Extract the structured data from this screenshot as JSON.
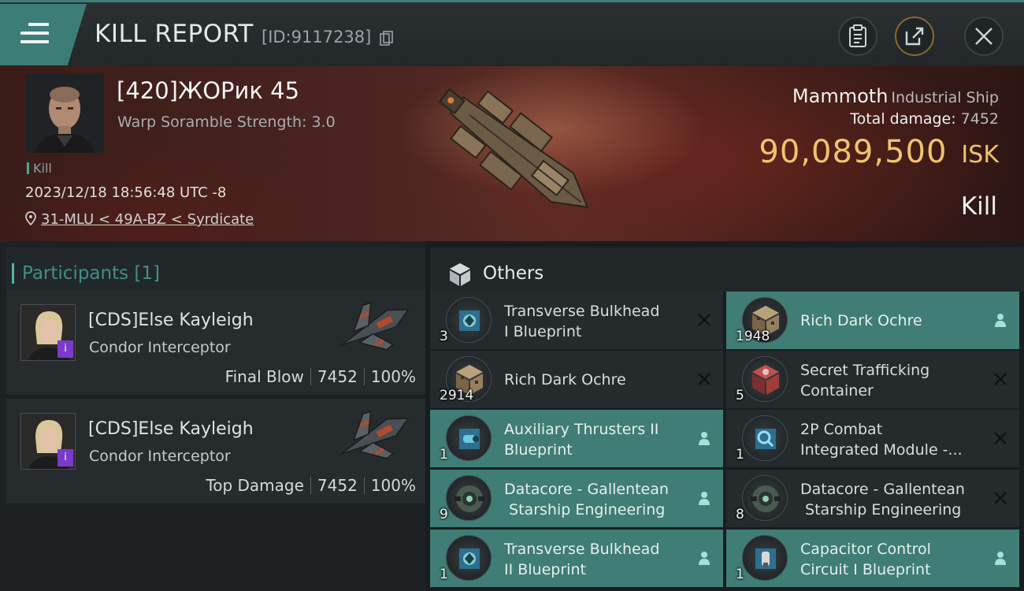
{
  "header": {
    "title": "KILL REPORT",
    "report_id": "[ID:9117238]"
  },
  "victim": {
    "name": "[420]ЖОРик 45",
    "subtitle": "Warp Soramble Strength: 3.0",
    "kill_tag": "Kill",
    "datetime": "2023/12/18 18:56:48 UTC -8",
    "location": "31-MLU < 49A-BZ < Syrdicate",
    "ship_name": "Mammoth",
    "ship_class": "Industrial Ship",
    "total_damage_label": "Total damage:",
    "total_damage": "7452",
    "isk_value": "90,089,500",
    "isk_unit": "ISK",
    "result": "Kill"
  },
  "participants": {
    "title": "Participants",
    "count": "[1]",
    "rows": [
      {
        "name": "[CDS]Else Kayleigh",
        "ship": "Condor Interceptor",
        "role": "Final Blow",
        "damage": "7452",
        "percent": "100%",
        "badge": "i"
      },
      {
        "name": "[CDS]Else Kayleigh",
        "ship": "Condor Interceptor",
        "role": "Top Damage",
        "damage": "7452",
        "percent": "100%",
        "badge": "i"
      }
    ]
  },
  "others": {
    "title": "Others",
    "items": [
      {
        "name_1": "Transverse Bulkhead",
        "name_2": "I Blueprint",
        "qty": "3",
        "state": "destroyed",
        "icon": "blueprint-module-icon"
      },
      {
        "name_1": "Rich Dark Ochre",
        "name_2": "",
        "qty": "1948",
        "state": "dropped",
        "icon": "ore-cube-icon"
      },
      {
        "name_1": "Rich Dark Ochre",
        "name_2": "",
        "qty": "2914",
        "state": "destroyed",
        "icon": "ore-cube-icon"
      },
      {
        "name_1": "Secret Trafficking",
        "name_2": "Container",
        "qty": "5",
        "state": "destroyed",
        "icon": "container-icon"
      },
      {
        "name_1": "Auxiliary Thrusters II",
        "name_2": "Blueprint",
        "qty": "1",
        "state": "dropped",
        "icon": "blueprint-thruster-icon"
      },
      {
        "name_1": "2P Combat",
        "name_2": "Integrated Module -...",
        "qty": "1",
        "state": "destroyed",
        "icon": "blueprint-combat-icon"
      },
      {
        "name_1": "Datacore - Gallentean",
        "name_2": " Starship Engineering",
        "qty": "9",
        "state": "dropped",
        "icon": "datacore-icon"
      },
      {
        "name_1": "Datacore - Gallentean",
        "name_2": " Starship Engineering",
        "qty": "8",
        "state": "destroyed",
        "icon": "datacore-icon"
      },
      {
        "name_1": "Transverse Bulkhead",
        "name_2": "II Blueprint",
        "qty": "1",
        "state": "dropped",
        "icon": "blueprint-module-icon"
      },
      {
        "name_1": "Capacitor Control",
        "name_2": "Circuit I Blueprint",
        "qty": "1",
        "state": "dropped",
        "icon": "blueprint-capacitor-icon"
      }
    ]
  },
  "colors": {
    "accent_teal": "#3f7d76",
    "isk_gold": "#f0c36e",
    "participants_title": "#3e8f88",
    "badge_purple": "#7c3acb"
  }
}
